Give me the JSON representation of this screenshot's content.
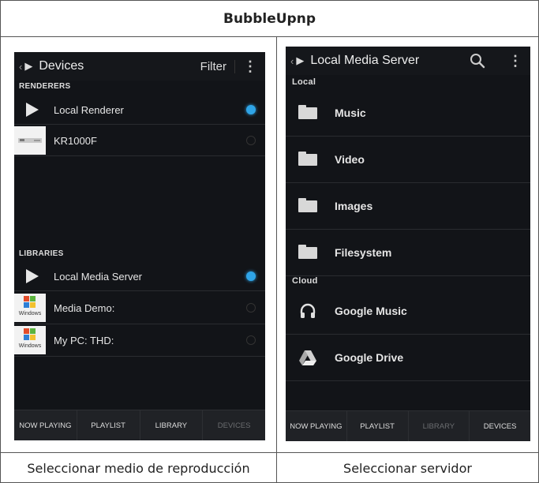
{
  "figure": {
    "title": "BubbleUpnp",
    "captions": {
      "left": "Seleccionar medio de reproducción",
      "right": "Seleccionar servidor"
    }
  },
  "left_screen": {
    "actionbar": {
      "title": "Devices",
      "filter_label": "Filter",
      "overflow": "⋮"
    },
    "renderers_header": "RENDERERS",
    "renderers": [
      {
        "name": "Local Renderer",
        "selected": true,
        "icon": "play-icon"
      },
      {
        "name": "KR1000F",
        "selected": false,
        "icon": "device-thumbnail"
      }
    ],
    "libraries_header": "LIBRARIES",
    "libraries": [
      {
        "name": "Local Media Server",
        "selected": true,
        "icon": "play-icon"
      },
      {
        "name": "Media Demo:",
        "selected": false,
        "icon": "windows-media-player-icon"
      },
      {
        "name": "My PC:  THD:",
        "selected": false,
        "icon": "windows-media-player-icon"
      }
    ],
    "wmp_caption": "Windows",
    "tabs": [
      {
        "label": "NOW PLAYING",
        "active": true
      },
      {
        "label": "PLAYLIST",
        "active": true
      },
      {
        "label": "LIBRARY",
        "active": true
      },
      {
        "label": "DEVICES",
        "active": false
      }
    ]
  },
  "right_screen": {
    "actionbar": {
      "title": "Local Media Server",
      "overflow": "⋮"
    },
    "local_header": "Local",
    "local_items": [
      {
        "label": "Music",
        "icon": "folder-icon"
      },
      {
        "label": "Video",
        "icon": "folder-icon"
      },
      {
        "label": "Images",
        "icon": "folder-icon"
      },
      {
        "label": "Filesystem",
        "icon": "folder-icon"
      }
    ],
    "cloud_header": "Cloud",
    "cloud_items": [
      {
        "label": "Google Music",
        "icon": "headphones-icon"
      },
      {
        "label": "Google Drive",
        "icon": "google-drive-icon"
      }
    ],
    "tabs": [
      {
        "label": "NOW PLAYING",
        "active": true
      },
      {
        "label": "PLAYLIST",
        "active": true
      },
      {
        "label": "LIBRARY",
        "active": false
      },
      {
        "label": "DEVICES",
        "active": true
      }
    ]
  },
  "colors": {
    "screen_bg": "#121418",
    "radio_selected": "#2fa4e7",
    "tab_dim": "#6b6d70"
  }
}
